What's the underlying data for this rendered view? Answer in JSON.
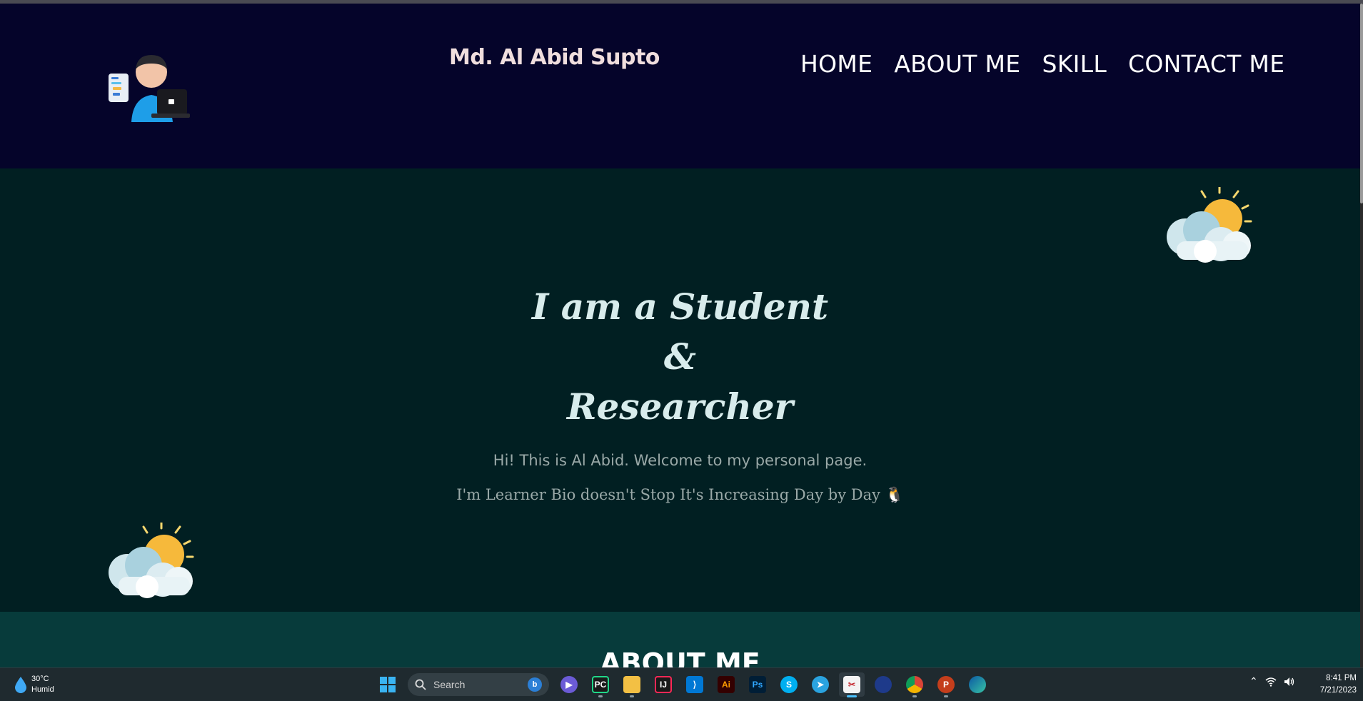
{
  "header": {
    "site_title": "Md. Al Abid Supto",
    "nav": [
      "HOME",
      "ABOUT ME",
      "SKILL",
      "CONTACT ME"
    ]
  },
  "hero": {
    "line1": "I am a Student",
    "line2": "&",
    "line3": "Researcher",
    "greeting": "Hi! This is Al Abid. Welcome to my personal page.",
    "bio": "I'm Learner Bio doesn't Stop It's Increasing Day by Day 🐧"
  },
  "about": {
    "heading": "ABOUT ME"
  },
  "taskbar": {
    "weather_temp": "30°C",
    "weather_desc": "Humid",
    "search_label": "Search",
    "apps": [
      "start",
      "search",
      "meet",
      "pycharm",
      "file-explorer",
      "intellij",
      "vscode",
      "illustrator",
      "photoshop",
      "skype",
      "telegram",
      "snipping-tool",
      "app-blue",
      "chrome",
      "powerpoint",
      "edge"
    ],
    "time": "8:41 PM",
    "date": "7/21/2023"
  },
  "colors": {
    "header_bg": "#05042a",
    "hero_bg": "#011f22",
    "about_bg": "#073b3b",
    "taskbar_bg": "#1f2a2f"
  }
}
